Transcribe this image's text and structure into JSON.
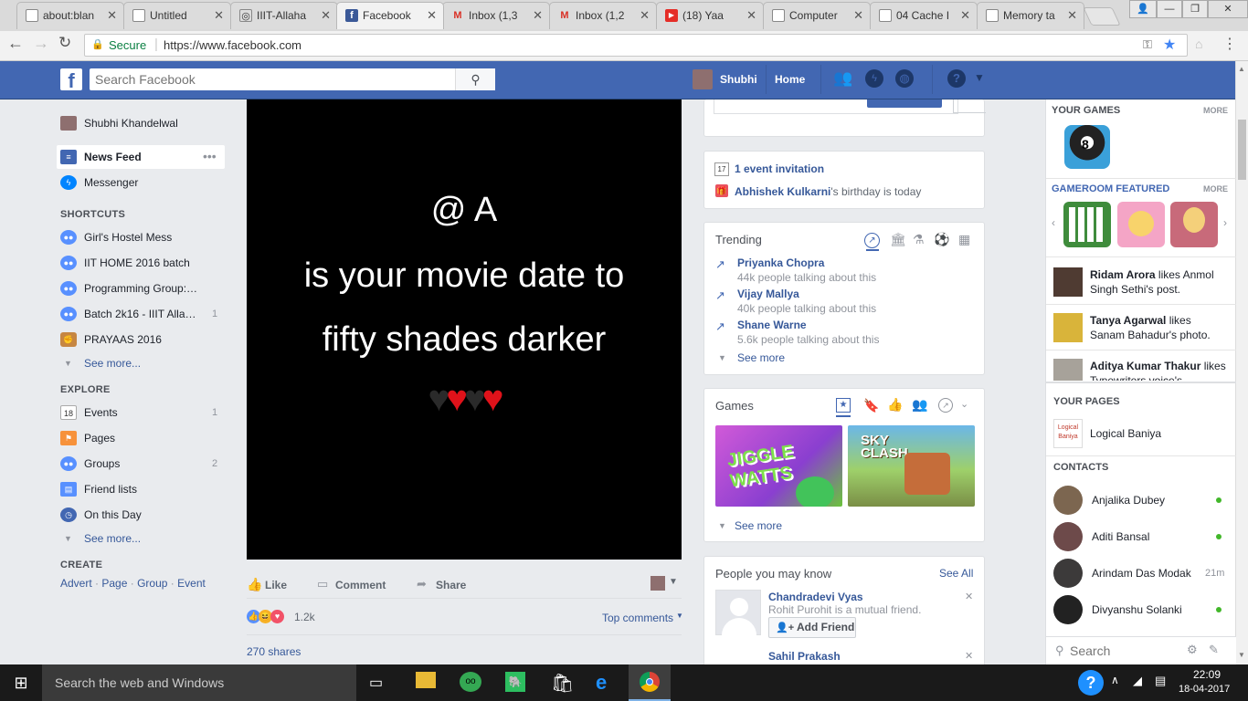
{
  "browser": {
    "tabs": [
      {
        "title": "about:blan",
        "icon": "page-icon"
      },
      {
        "title": "Untitled",
        "icon": "page-icon"
      },
      {
        "title": "IIIT-Allaha",
        "icon": "globe-icon"
      },
      {
        "title": "Facebook",
        "icon": "facebook-icon"
      },
      {
        "title": "Inbox (1,3",
        "icon": "gmail-icon"
      },
      {
        "title": "Inbox (1,2",
        "icon": "gmail-icon"
      },
      {
        "title": "(18) Yaa",
        "icon": "youtube-icon"
      },
      {
        "title": "Computer",
        "icon": "page-icon"
      },
      {
        "title": "04 Cache I",
        "icon": "page-icon"
      },
      {
        "title": "Memory ta",
        "icon": "page-icon"
      }
    ],
    "secure_label": "Secure",
    "url": "https://www.facebook.com"
  },
  "fb_header": {
    "search_placeholder": "Search Facebook",
    "user_name": "Shubhi",
    "home_label": "Home"
  },
  "left_nav": {
    "profile_name": "Shubhi Khandelwal",
    "news_feed": "News Feed",
    "messenger": "Messenger",
    "shortcuts_title": "SHORTCUTS",
    "shortcuts": [
      {
        "label": "Girl's Hostel Mess",
        "count": ""
      },
      {
        "label": "IIT HOME 2016 batch",
        "count": ""
      },
      {
        "label": "Programming Group:…",
        "count": ""
      },
      {
        "label": "Batch 2k16 - IIIT Alla…",
        "count": "1"
      },
      {
        "label": "PRAYAAS 2016",
        "count": ""
      }
    ],
    "see_more_1": "See more...",
    "explore_title": "EXPLORE",
    "explore": [
      {
        "label": "Events",
        "count": "1"
      },
      {
        "label": "Pages",
        "count": ""
      },
      {
        "label": "Groups",
        "count": "2"
      },
      {
        "label": "Friend lists",
        "count": ""
      },
      {
        "label": "On this Day",
        "count": ""
      }
    ],
    "see_more_2": "See more...",
    "create_title": "CREATE",
    "create_links": [
      "Advert",
      "Page",
      "Group",
      "Event"
    ],
    "events_date": "18"
  },
  "post": {
    "image_text_1": "@ A",
    "image_text_2": "is your movie date to",
    "image_text_3": "fifty shades darker",
    "like": "Like",
    "comment": "Comment",
    "share": "Share",
    "reactions_count": "1.2k",
    "top_comments": "Top comments",
    "shares": "270 shares"
  },
  "events_card": {
    "invitation": "1 event invitation",
    "birthday_name": "Abhishek Kulkarni",
    "birthday_suffix": "'s birthday is today",
    "calendar_date": "17"
  },
  "trending": {
    "title": "Trending",
    "items": [
      {
        "name": "Priyanka Chopra",
        "meta": "44k people talking about this"
      },
      {
        "name": "Vijay Mallya",
        "meta": "40k people talking about this"
      },
      {
        "name": "Shane Warne",
        "meta": "5.6k people talking about this"
      }
    ],
    "see_more": "See more"
  },
  "games_card": {
    "title": "Games",
    "game_1": "JIGGLE WATTS",
    "game_2": "SKY CLASH",
    "see_more": "See more"
  },
  "pymk": {
    "title": "People you may know",
    "see_all": "See All",
    "people": [
      {
        "name": "Chandradevi Vyas",
        "mutual": "Rohit Purohit is a mutual friend.",
        "button": "Add Friend"
      },
      {
        "name": "Sahil Prakash"
      }
    ]
  },
  "right_sidebar": {
    "your_games": "YOUR GAMES",
    "more": "MORE",
    "gameroom": "GAMEROOM FEATURED",
    "ticker": [
      {
        "name": "Ridam Arora",
        "text": " likes Anmol Singh Sethi's post."
      },
      {
        "name": "Tanya Agarwal",
        "text": " likes Sanam Bahadur's photo."
      },
      {
        "name": "Aditya Kumar Thakur",
        "text": " likes Typewriters voice's"
      }
    ],
    "your_pages": "YOUR PAGES",
    "page_name": "Logical Baniya",
    "contacts_title": "CONTACTS",
    "contacts": [
      {
        "name": "Anjalika Dubey",
        "status": "online"
      },
      {
        "name": "Aditi Bansal",
        "status": "online"
      },
      {
        "name": "Arindam Das Modak",
        "status": "21m"
      },
      {
        "name": "Divyanshu Solanki",
        "status": "online"
      }
    ],
    "chat_search": "Search"
  },
  "taskbar": {
    "search_placeholder": "Search the web and Windows",
    "time": "22:09",
    "date": "18-04-2017"
  },
  "colors": {
    "fb_blue": "#4267b2",
    "link": "#365899",
    "online": "#42b72a"
  }
}
